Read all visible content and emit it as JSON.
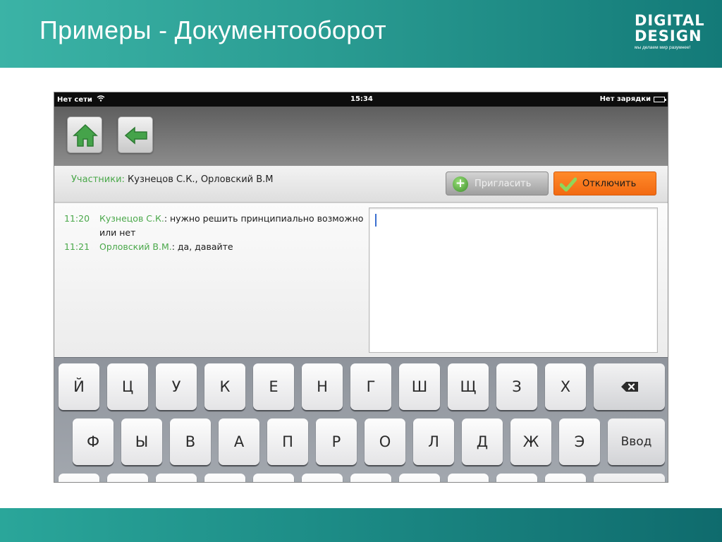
{
  "slide": {
    "title": "Примеры - Документооборот",
    "logo": {
      "line1": "DIGITAL",
      "line2": "DESIGN",
      "tagline": "мы делаем мир разумнее!"
    }
  },
  "status_bar": {
    "network": "Нет сети",
    "time": "15:34",
    "charging": "Нет зарядки"
  },
  "toolbar": {
    "home_icon": "home-icon",
    "back_icon": "back-arrow-icon"
  },
  "participants": {
    "label": "Участники:",
    "names": " Кузнецов С.К., Орловский В.М"
  },
  "buttons": {
    "invite": "Пригласить",
    "disconnect": "Отключить"
  },
  "chat": {
    "messages": [
      {
        "time": "11:20",
        "author": "Кузнецов С.К.",
        "text": ": нужно решить принципиально возможно или нет"
      },
      {
        "time": "11:21",
        "author": "Орловский В.М.",
        "text": ": да, давайте"
      }
    ]
  },
  "keyboard": {
    "row1": [
      "Й",
      "Ц",
      "У",
      "К",
      "Е",
      "Н",
      "Г",
      "Ш",
      "Щ",
      "З",
      "Х"
    ],
    "backspace_icon": "backspace-icon",
    "row2": [
      "Ф",
      "Ы",
      "В",
      "А",
      "П",
      "Р",
      "О",
      "Л",
      "Д",
      "Ж",
      "Э"
    ],
    "enter": "Ввод"
  },
  "colors": {
    "accent_green": "#4aa84a",
    "disconnect_orange": "#f26a12",
    "header_teal": "#2a9c92"
  }
}
